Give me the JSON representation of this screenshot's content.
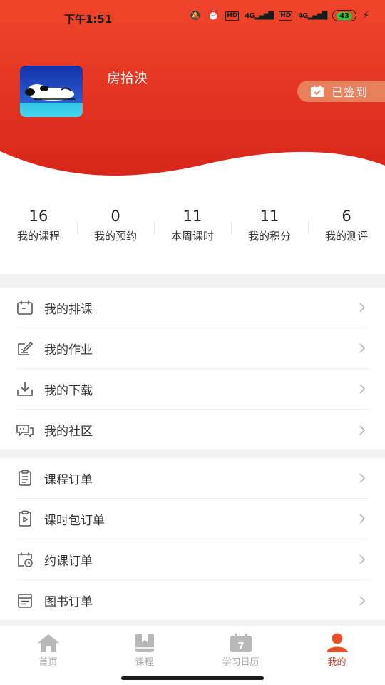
{
  "status_bar": {
    "time": "下午1:51",
    "battery": "43",
    "network_1": "4G",
    "network_2": "4G",
    "hd_1": "HD",
    "hd_2": "HD"
  },
  "profile": {
    "username": "房拾泱",
    "signin_label": "已签到"
  },
  "stats": [
    {
      "value": "16",
      "label": "我的课程"
    },
    {
      "value": "0",
      "label": "我的预约"
    },
    {
      "value": "11",
      "label": "本周课时"
    },
    {
      "value": "11",
      "label": "我的积分"
    },
    {
      "value": "6",
      "label": "我的测评"
    }
  ],
  "menu_group_1": [
    {
      "label": "我的排课",
      "icon": "calendar-icon"
    },
    {
      "label": "我的作业",
      "icon": "edit-note-icon"
    },
    {
      "label": "我的下载",
      "icon": "download-icon"
    },
    {
      "label": "我的社区",
      "icon": "chat-bubbles-icon"
    }
  ],
  "menu_group_2": [
    {
      "label": "课程订单",
      "icon": "clipboard-list-icon"
    },
    {
      "label": "课时包订单",
      "icon": "clipboard-play-icon"
    },
    {
      "label": "约课订单",
      "icon": "calendar-clock-icon"
    },
    {
      "label": "图书订单",
      "icon": "book-order-icon"
    }
  ],
  "tabbar": [
    {
      "label": "首页",
      "icon": "home-icon",
      "active": false
    },
    {
      "label": "课程",
      "icon": "bookmark-book-icon",
      "active": false
    },
    {
      "label": "学习日历",
      "icon": "calendar-day-icon",
      "active": false,
      "badge": "7"
    },
    {
      "label": "我的",
      "icon": "person-icon",
      "active": true
    }
  ],
  "colors": {
    "header_top": "#f24a2c",
    "header_bottom": "#d92b1c",
    "accent": "#e0401f",
    "signin_bg": "#e8805e",
    "tab_inactive": "#aaaaaa"
  }
}
